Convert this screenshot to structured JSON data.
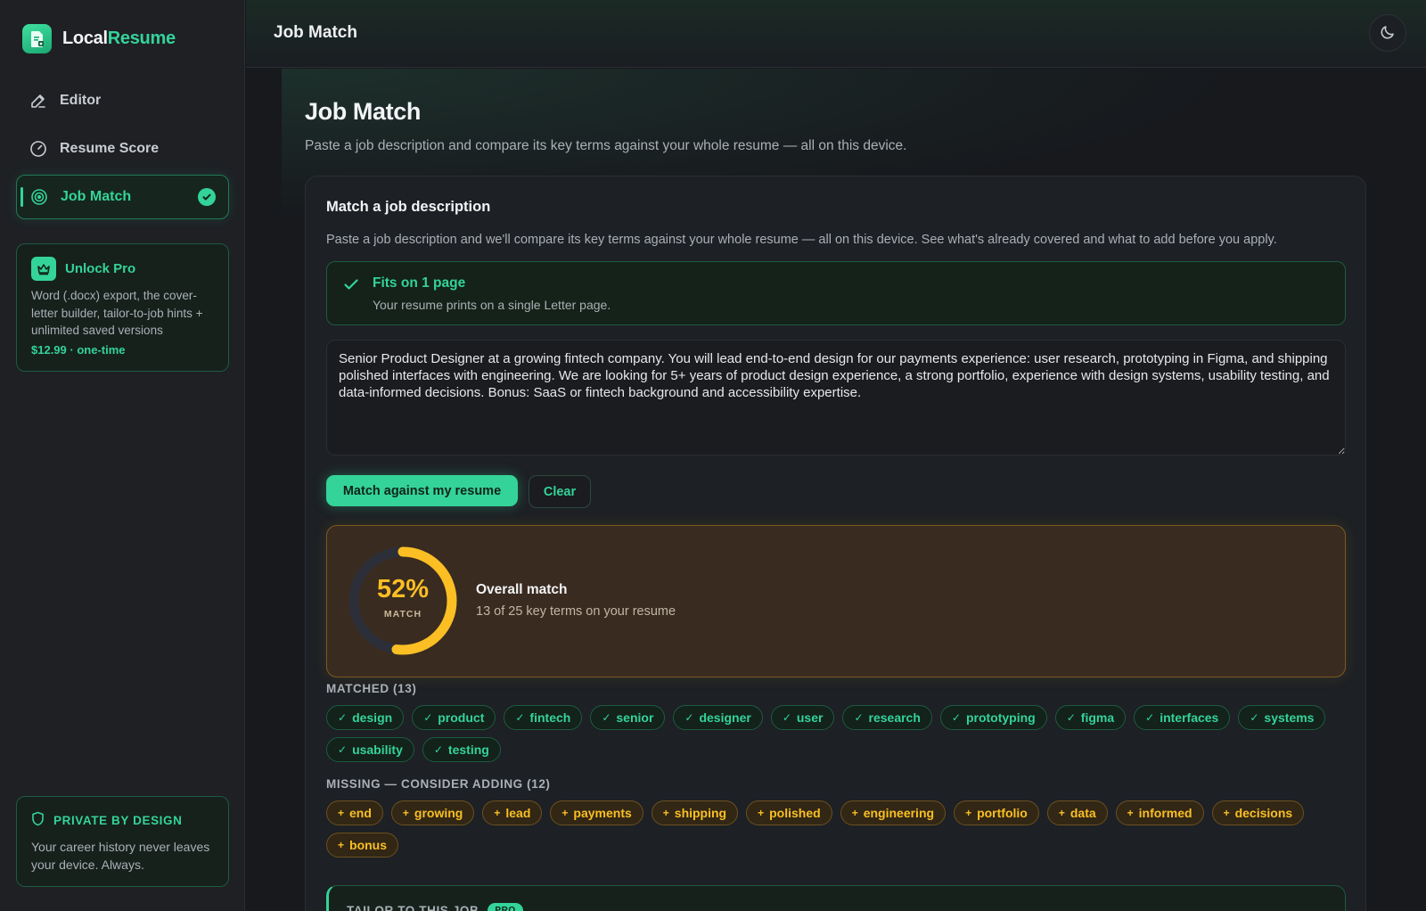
{
  "brand": {
    "name_main": "Local",
    "name_accent": "Resume"
  },
  "nav": [
    {
      "label": "Editor"
    },
    {
      "label": "Resume Score"
    },
    {
      "label": "Job Match"
    }
  ],
  "pro_card": {
    "title": "Unlock Pro",
    "description": "Word (.docx) export, the cover-letter builder, tailor-to-job hints + unlimited saved versions",
    "price": "$12.99 · one-time"
  },
  "privacy_card": {
    "title": "PRIVATE BY DESIGN",
    "description": "Your career history never leaves your device. Always."
  },
  "topbar": {
    "title": "Job Match"
  },
  "page": {
    "title": "Job Match",
    "subtitle": "Paste a job description and compare its key terms against your whole resume — all on this device."
  },
  "match_card": {
    "title": "Match a job description",
    "description": "Paste a job description and we'll compare its key terms against your whole resume — all on this device. See what's already covered and what to add before you apply.",
    "fit": {
      "title": "Fits on 1 page",
      "description": "Your resume prints on a single Letter page."
    },
    "job_description": "Senior Product Designer at a growing fintech company. You will lead end-to-end design for our payments experience: user research, prototyping in Figma, and shipping polished interfaces with engineering. We are looking for 5+ years of product design experience, a strong portfolio, experience with design systems, usability testing, and data-informed decisions. Bonus: SaaS or fintech background and accessibility expertise.",
    "match_button": "Match against my resume",
    "clear_button": "Clear"
  },
  "score": {
    "percent_label": "52%",
    "percent_value": 52,
    "unit": "MATCH",
    "title": "Overall match",
    "description": "13 of 25 key terms on your resume",
    "ring_color": "#fbbf24",
    "track_color": "#2c2f38"
  },
  "matched": {
    "label": "MATCHED (13)",
    "terms": [
      "design",
      "product",
      "fintech",
      "senior",
      "designer",
      "user",
      "research",
      "prototyping",
      "figma",
      "interfaces",
      "systems",
      "usability",
      "testing"
    ]
  },
  "missing": {
    "label": "MISSING — CONSIDER ADDING (12)",
    "terms": [
      "end",
      "growing",
      "lead",
      "payments",
      "shipping",
      "polished",
      "engineering",
      "portfolio",
      "data",
      "informed",
      "decisions",
      "bonus"
    ]
  },
  "tailor": {
    "title": "TAILOR TO THIS JOB",
    "badge": "PRO"
  },
  "colors": {
    "accent": "#34d399",
    "warning": "#fbbf24",
    "background": "#17191d"
  }
}
